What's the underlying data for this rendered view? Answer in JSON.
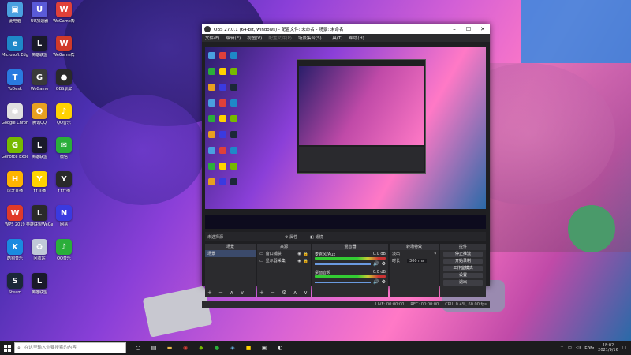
{
  "desktop_icons": [
    {
      "label": "此电脑",
      "color": "#4aa0e0",
      "glyph": "▣"
    },
    {
      "label": "UU加速器",
      "color": "#5a5ad8",
      "glyph": "U"
    },
    {
      "label": "WeGame帮",
      "color": "#e0403a",
      "glyph": "W"
    },
    {
      "label": "Microsoft Edge",
      "color": "#1e88c8",
      "glyph": "e"
    },
    {
      "label": "英雄联盟",
      "color": "#1a1a2a",
      "glyph": "L"
    },
    {
      "label": "WeGame帮",
      "color": "#d03a2a",
      "glyph": "W"
    },
    {
      "label": "ToDesk",
      "color": "#2a7ae0",
      "glyph": "T"
    },
    {
      "label": "WeGame",
      "color": "#3a3a3a",
      "glyph": "G"
    },
    {
      "label": "OBS录屏",
      "color": "#2a2a2a",
      "glyph": "●"
    },
    {
      "label": "Google Chrome",
      "color": "#e0e0e0",
      "glyph": "◉"
    },
    {
      "label": "腾讯QQ",
      "color": "#e8a020",
      "glyph": "Q"
    },
    {
      "label": "QQ音乐",
      "color": "#ffd200",
      "glyph": "♪"
    },
    {
      "label": "GeForce Experience",
      "color": "#76b900",
      "glyph": "G"
    },
    {
      "label": "英雄联盟",
      "color": "#1a1a2a",
      "glyph": "L"
    },
    {
      "label": "微信",
      "color": "#2aae3a",
      "glyph": "✉"
    },
    {
      "label": "虎牙直播",
      "color": "#ffb400",
      "glyph": "H"
    },
    {
      "label": "YY直播",
      "color": "#ffd400",
      "glyph": "Y"
    },
    {
      "label": "YY开播",
      "color": "#2a2a2a",
      "glyph": "Y"
    },
    {
      "label": "WPS 2019",
      "color": "#e03a2a",
      "glyph": "W"
    },
    {
      "label": "英雄联盟WeGame",
      "color": "#2a2a2a",
      "glyph": "L"
    },
    {
      "label": "网易",
      "color": "#3a3ae0",
      "glyph": "N"
    },
    {
      "label": "酷狗音乐",
      "color": "#1a8ae0",
      "glyph": "K"
    },
    {
      "label": "回收站",
      "color": "#c0c8d8",
      "glyph": "♻"
    },
    {
      "label": "QQ音乐",
      "color": "#2aae3a",
      "glyph": "♪"
    },
    {
      "label": "Steam",
      "color": "#1b2838",
      "glyph": "S"
    },
    {
      "label": "英雄联盟",
      "color": "#1a1a2a",
      "glyph": "L"
    }
  ],
  "obs": {
    "title": "OBS 27.0.1 (64-bit, windows) - 配置文件: 未命名 - 场景: 未命名",
    "menu": [
      "文件(F)",
      "编辑(E)",
      "视图(V)",
      "配置文件(P)",
      "场景集合(S)",
      "工具(T)",
      "帮助(H)"
    ],
    "scene_bar": {
      "label": "未选择源",
      "props": "属性",
      "filters": "滤镜"
    },
    "scenes": {
      "header": "场景",
      "items": [
        "场景"
      ]
    },
    "sources": {
      "header": "来源",
      "items": [
        "窗口捕获",
        "显示器采集"
      ]
    },
    "mixer": {
      "header": "混音器",
      "tracks": [
        {
          "name": "麦克风/Aux",
          "db": "0.0 dB"
        },
        {
          "name": "桌面音频",
          "db": "0.0 dB"
        }
      ]
    },
    "transitions": {
      "header": "转场特效",
      "type": "淡出",
      "duration_label": "时长",
      "duration": "300 ms"
    },
    "controls": {
      "header": "控件",
      "buttons": [
        "停止推流",
        "开始录制",
        "工作室模式",
        "设置",
        "退出"
      ]
    },
    "status": {
      "live": "LIVE: 00:00:00",
      "rec": "REC: 00:00:00",
      "cpu": "CPU: 0.4%, 60.00 fps"
    }
  },
  "taskbar": {
    "search_placeholder": "在这里输入你要搜索的内容",
    "lang": "ENG",
    "time": "18:02",
    "date": "2021/9/16"
  }
}
